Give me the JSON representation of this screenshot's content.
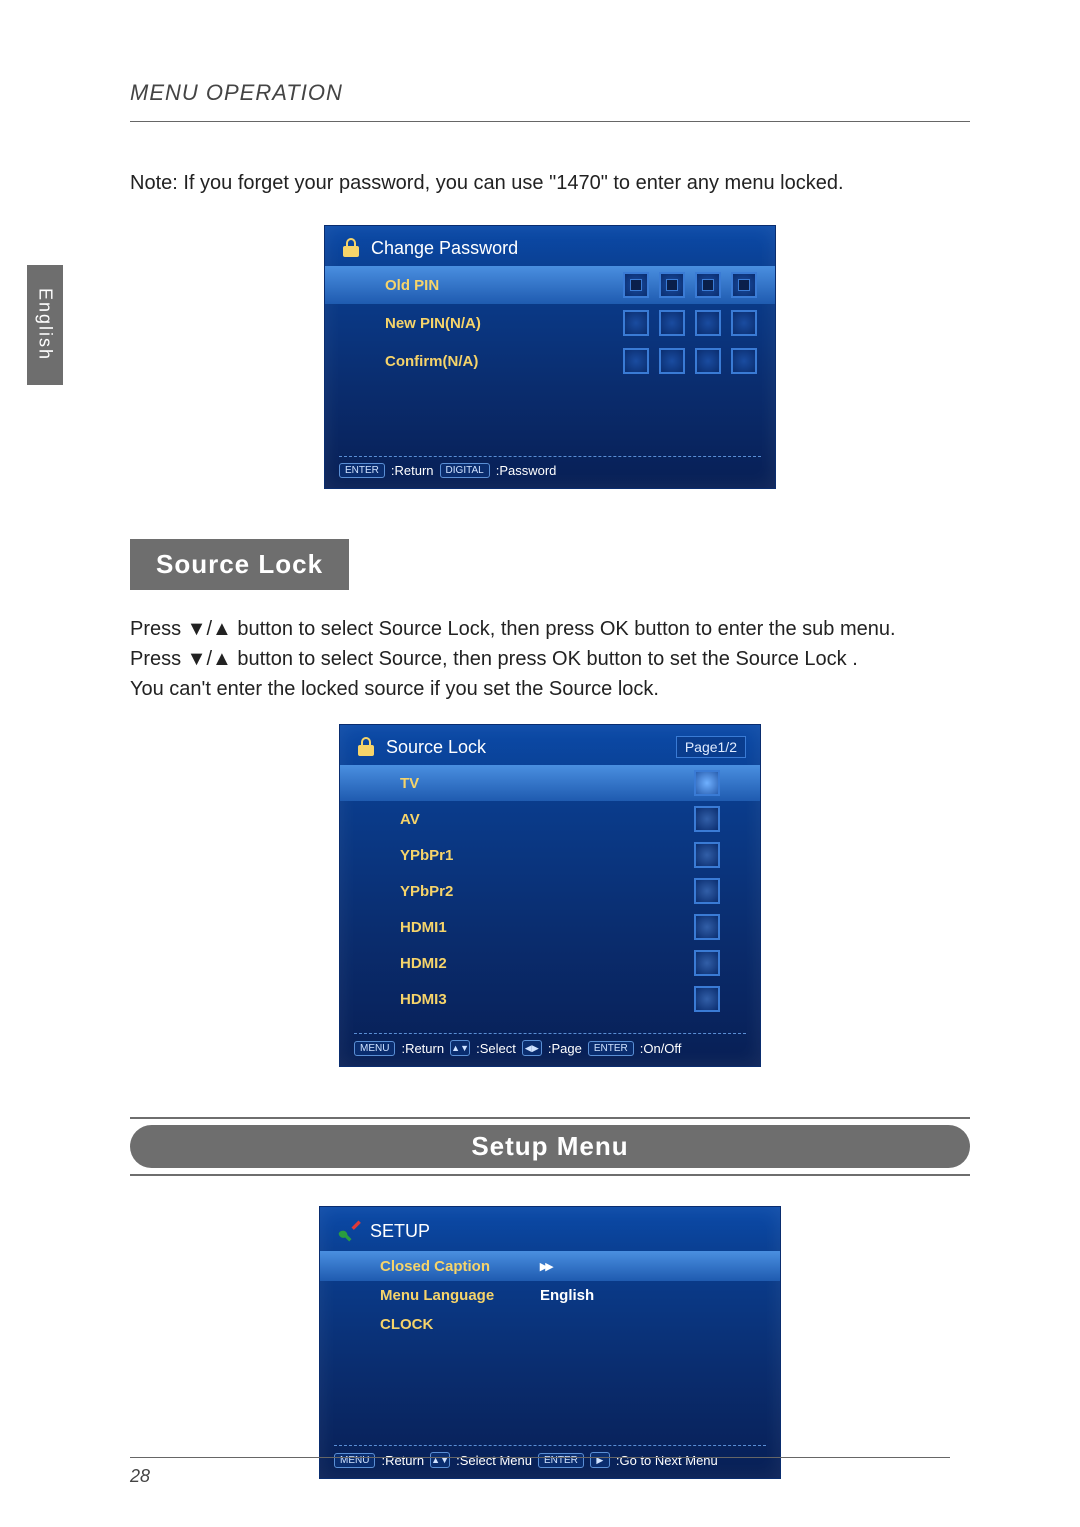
{
  "header": {
    "title": "MENU OPERATION"
  },
  "side_tab": "English",
  "note": "Note: If you forget your password, you can use \"1470\" to enter any menu locked.",
  "password_box": {
    "title": "Change Password",
    "rows": [
      {
        "label": "Old PIN"
      },
      {
        "label": "New PIN(N/A)"
      },
      {
        "label": "Confirm(N/A)"
      }
    ],
    "footer": {
      "k1": "ENTER",
      "t1": ":Return",
      "k2": "DIGITAL",
      "t2": ":Password"
    }
  },
  "section_tag": "Source Lock",
  "source_text_lines": [
    "Press ▼/▲ button to select Source Lock, then press OK button to enter the sub menu.",
    "Press ▼/▲ button to select Source, then press OK button to set the Source Lock .",
    "You can't enter the locked source if you set the Source lock."
  ],
  "source_lock_box": {
    "title": "Source Lock",
    "page": "Page1/2",
    "items": [
      "TV",
      "AV",
      "YPbPr1",
      "YPbPr2",
      "HDMI1",
      "HDMI2",
      "HDMI3"
    ],
    "footer": {
      "k1": "MENU",
      "t1": ":Return",
      "t2": ":Select",
      "t3": ":Page",
      "k4": "ENTER",
      "t4": ":On/Off"
    }
  },
  "setup_pill": "Setup Menu",
  "setup_box": {
    "title": "SETUP",
    "rows": [
      {
        "label": "Closed Caption",
        "value": "▸▸"
      },
      {
        "label": "Menu Language",
        "value": "English"
      },
      {
        "label": "CLOCK",
        "value": ""
      }
    ],
    "footer": {
      "k1": "MENU",
      "t1": ":Return",
      "t2": ":Select Menu",
      "k3": "ENTER",
      "t3": ":Go to Next Menu"
    }
  },
  "page_number": "28"
}
